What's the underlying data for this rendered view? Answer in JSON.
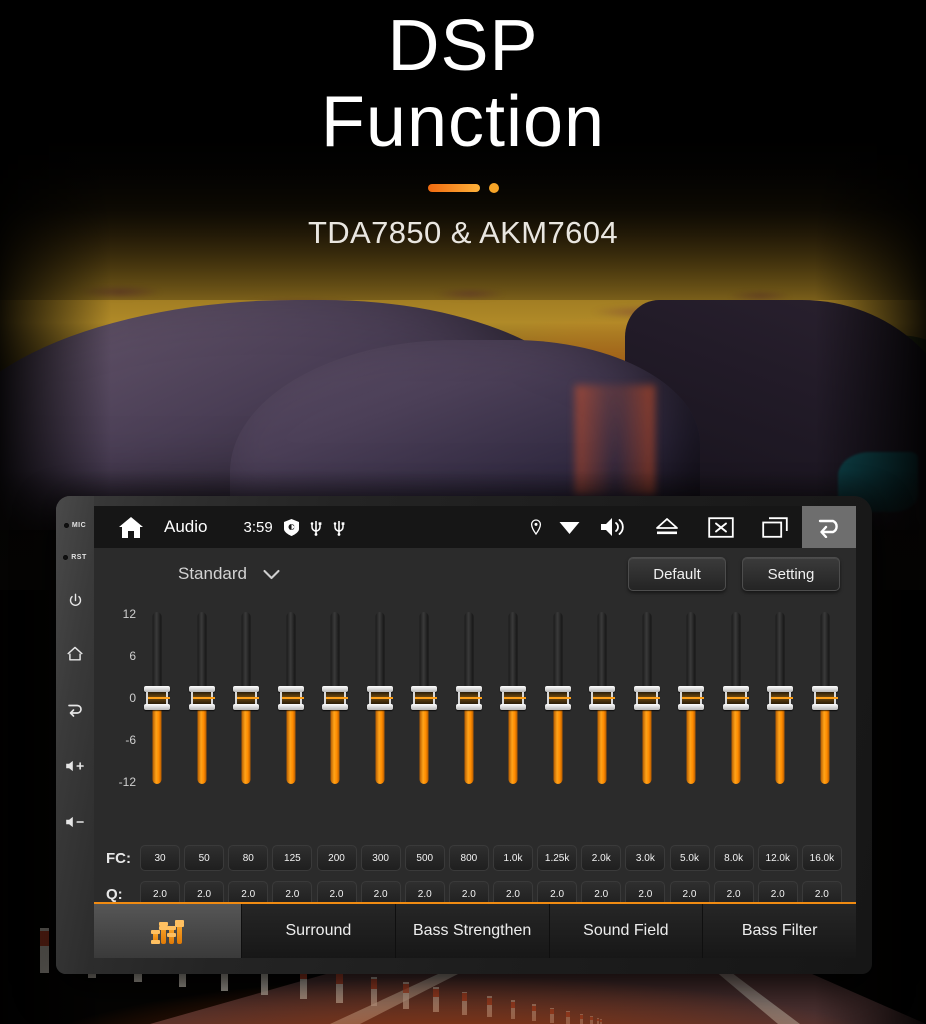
{
  "hero": {
    "title_line1": "DSP",
    "title_line2": "Function",
    "subtitle": "TDA7850 & AKM7604",
    "accent_color": "#f7a427"
  },
  "device": {
    "bezel": {
      "mic_label": "MIC",
      "rst_label": "RST",
      "power_icon": "power-icon",
      "home_icon": "home-icon",
      "back_icon": "back-icon",
      "volume_up_icon": "volume-up-icon",
      "volume_down_icon": "volume-down-icon"
    },
    "statusbar": {
      "home_icon": "home-icon",
      "title": "Audio",
      "time": "3:59",
      "sd_icon": "sd-card-icon",
      "usb1_icon": "usb-icon",
      "usb2_icon": "usb-icon",
      "location_icon": "location-pin-icon",
      "wifi_icon": "wifi-icon",
      "volume_icon": "speaker-icon",
      "eject_icon": "eject-icon",
      "close_icon": "close-box-icon",
      "recents_icon": "recent-apps-icon",
      "back_icon": "back-arrow-icon"
    },
    "toolbar": {
      "preset_value": "Standard",
      "preset_caret_icon": "chevron-down-icon",
      "default_label": "Default",
      "setting_label": "Setting"
    },
    "eq": {
      "scale_labels": [
        "12",
        "6",
        "0",
        "-6",
        "-12"
      ],
      "fc_label": "FC:",
      "q_label": "Q:",
      "bands": [
        {
          "fc": "30",
          "q": "2.0",
          "gain": 0
        },
        {
          "fc": "50",
          "q": "2.0",
          "gain": 0
        },
        {
          "fc": "80",
          "q": "2.0",
          "gain": 0
        },
        {
          "fc": "125",
          "q": "2.0",
          "gain": 0
        },
        {
          "fc": "200",
          "q": "2.0",
          "gain": 0
        },
        {
          "fc": "300",
          "q": "2.0",
          "gain": 0
        },
        {
          "fc": "500",
          "q": "2.0",
          "gain": 0
        },
        {
          "fc": "800",
          "q": "2.0",
          "gain": 0
        },
        {
          "fc": "1.0k",
          "q": "2.0",
          "gain": 0
        },
        {
          "fc": "1.25k",
          "q": "2.0",
          "gain": 0
        },
        {
          "fc": "2.0k",
          "q": "2.0",
          "gain": 0
        },
        {
          "fc": "3.0k",
          "q": "2.0",
          "gain": 0
        },
        {
          "fc": "5.0k",
          "q": "2.0",
          "gain": 0
        },
        {
          "fc": "8.0k",
          "q": "2.0",
          "gain": 0
        },
        {
          "fc": "12.0k",
          "q": "2.0",
          "gain": 0
        },
        {
          "fc": "16.0k",
          "q": "2.0",
          "gain": 0
        }
      ]
    },
    "tabs": [
      {
        "label": "",
        "icon": "equalizer-icon",
        "active": true
      },
      {
        "label": "Surround",
        "active": false
      },
      {
        "label": "Bass Strengthen",
        "active": false
      },
      {
        "label": "Sound Field",
        "active": false
      },
      {
        "label": "Bass Filter",
        "active": false
      }
    ]
  }
}
